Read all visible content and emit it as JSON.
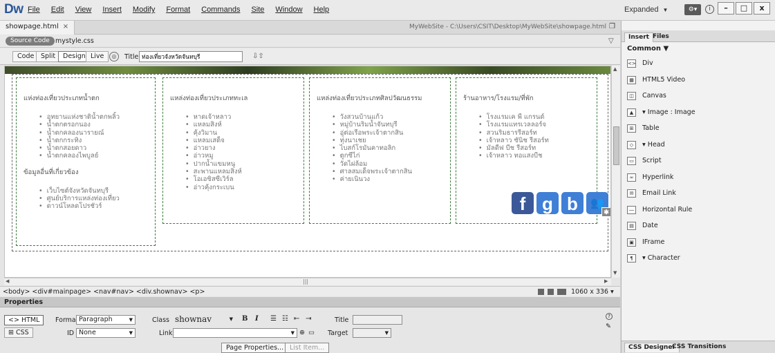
{
  "app": {
    "logo": "Dw"
  },
  "menu": [
    "File",
    "Edit",
    "View",
    "Insert",
    "Modify",
    "Format",
    "Commands",
    "Site",
    "Window",
    "Help"
  ],
  "workspace": {
    "label": "Expanded"
  },
  "window_buttons": {
    "minimize": "–",
    "maximize": "□",
    "close": "x"
  },
  "document": {
    "tab_name": "showpage.html",
    "tab_close": "×",
    "path": "MyWebSite - C:\\Users\\CSIT\\Desktop\\MyWebSite\\showpage.html",
    "source_code_label": "Source Code",
    "related_file": "mystyle.css"
  },
  "toolbar": {
    "code": "Code",
    "split": "Split",
    "design": "Design",
    "live": "Live",
    "title_label": "Title:",
    "title_value": "ท่องเที่ยวจังหวัดจันทบุรี"
  },
  "columns": [
    {
      "heading": "แห่งท่องเที่ยวประเภทน้ำตก",
      "items": [
        "อุทยานแห่งชาติน้ำตกพลิ้ว",
        "น้ำตกตรอกนอง",
        "น้ำตกคลองนารายณ์",
        "น้ำตกกระทิง",
        "น้ำตกสอยดาว",
        "น้ำตกคลองไพบูลย์"
      ],
      "sub_heading": "ข้อมูลอื่นที่เกี่ยวข้อง",
      "sub_items": [
        "เว็บไซต์จังหวัดจันทบุรี",
        "ศูนย์บริการแหล่งท่องเที่ยว",
        "ดาวน์โหลดโปรชัวร์"
      ]
    },
    {
      "heading": "แหล่งท่องเที่ยวประเภททะเล",
      "items": [
        "หาดเจ้าหลาว",
        "แหลมสิงห์",
        "คุ้งวิมาน",
        "แหลมเสด็จ",
        "อ่าวยาง",
        "อ่าวหมู",
        "ปากน้ำแขมหนู",
        "สะพานแหลมสิงห์",
        "โอเอซิสซีเวิร์ล",
        "อ่าวคุ้งกระเบน"
      ]
    },
    {
      "heading": "แหล่งท่องเที่ยวประเภทศิลปวัฒนธรรม",
      "items": [
        "วังสวนบ้านแก้ว",
        "หมู่บ้านริมน้ำจันทบุรี",
        "อู่ต่อเรือพระเจ้าตากสิน",
        "ทุ่งนาเชย",
        "ไบสก์โรมันคาทอลิก",
        "ตูกซีไก่",
        "วัดไผ่ล้อม",
        "ศาลสมเด็จพระเจ้าตากสิน",
        "ค่ายเนินวง"
      ]
    },
    {
      "heading": "ร้านอาหาร/โรงแรม/ที่พัก",
      "items": [
        "โรงแรมเค พี แกรนด์",
        "โรงแรมแทรเวลลอร์จ",
        "สวนริมธารรีสอร์ท",
        "เจ้าหลาว ซันิช รีสอร์ท",
        "มัลดีฟ บีช รีสอร์ท",
        "เจ้าหลาว ทอแสงบีช"
      ]
    }
  ],
  "social": {
    "facebook": "f",
    "gplus": "g",
    "blogger": "b"
  },
  "tagbar": {
    "path": "<body> <div#mainpage> <nav#nav> <div.shownav> <p>",
    "size": "1060 x 336"
  },
  "properties": {
    "title": "Properties",
    "html_tab": "HTML",
    "css_tab": "CSS",
    "format_label": "Format",
    "format_value": "Paragraph",
    "id_label": "ID",
    "id_value": "None",
    "class_label": "Class",
    "class_value": "shownav",
    "link_label": "Link",
    "bold": "B",
    "italic": "I",
    "title_label": "Title",
    "target_label": "Target",
    "page_properties": "Page Properties...",
    "list_item": "List Item..."
  },
  "right_panel": {
    "tabs": [
      "Insert",
      "Files"
    ],
    "category": "Common",
    "items": [
      {
        "icon": "div-icon",
        "label": "Div"
      },
      {
        "icon": "video-icon",
        "label": "HTML5 Video"
      },
      {
        "icon": "canvas-icon",
        "label": "Canvas"
      },
      {
        "icon": "image-icon",
        "label": "Image : Image"
      },
      {
        "icon": "table-icon",
        "label": "Table"
      },
      {
        "icon": "head-icon",
        "label": "Head"
      },
      {
        "icon": "script-icon",
        "label": "Script"
      },
      {
        "icon": "hyperlink-icon",
        "label": "Hyperlink"
      },
      {
        "icon": "email-icon",
        "label": "Email Link"
      },
      {
        "icon": "hrule-icon",
        "label": "Horizontal Rule"
      },
      {
        "icon": "date-icon",
        "label": "Date"
      },
      {
        "icon": "iframe-icon",
        "label": "IFrame"
      },
      {
        "icon": "character-icon",
        "label": "Character"
      }
    ],
    "bottom_tabs": [
      "CSS Designer",
      "CSS Transitions"
    ]
  }
}
